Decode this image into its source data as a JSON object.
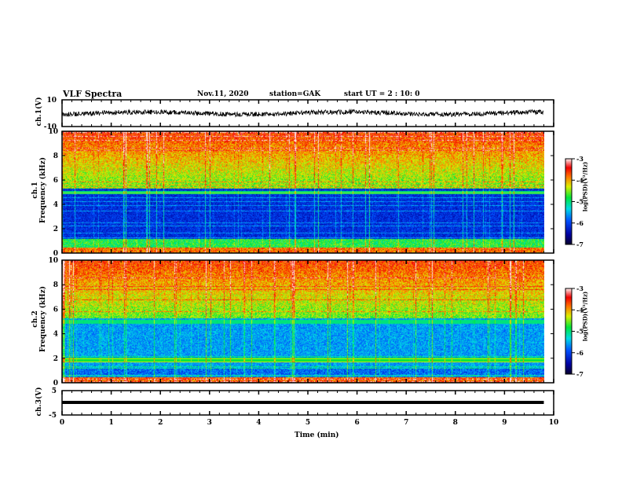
{
  "header": {
    "title": "VLF Spectra",
    "date": "Nov.11, 2020",
    "station": "station=GAK",
    "start": "start  UT =   2 : 10: 0"
  },
  "chart_data": [
    {
      "type": "line",
      "ylabel": "ch.1(V)",
      "ylim": [
        -10,
        10
      ],
      "yticks": [
        "10",
        "-10"
      ],
      "xlim": [
        0,
        10
      ],
      "note_values": "noisy waveform near 0 V from 0 to ~9.8 min"
    },
    {
      "type": "heatmap",
      "ylabel": "ch.1\nFrequency (kHz)",
      "ylabel_lines": [
        "ch.1",
        "Frequency (kHz)"
      ],
      "ylim": [
        0,
        10
      ],
      "yticks": [
        "0",
        "2",
        "4",
        "6",
        "8",
        "10"
      ],
      "xlim": [
        0,
        10
      ],
      "colorbar": {
        "label": "log(PSD)(V²/Hz)",
        "range": [
          -7,
          -3
        ],
        "ticks": [
          "-3",
          "-4",
          "-5",
          "-6",
          "-7"
        ]
      }
    },
    {
      "type": "heatmap",
      "ylabel_lines": [
        "ch.2",
        "Frequency (kHz)"
      ],
      "ylim": [
        0,
        10
      ],
      "yticks": [
        "0",
        "2",
        "4",
        "6",
        "8",
        "10"
      ],
      "xlim": [
        0,
        10
      ],
      "colorbar": {
        "label": "log(PSD)(V²/Hz)",
        "range": [
          -7,
          -3
        ],
        "ticks": [
          "-3",
          "-4",
          "-5",
          "-6",
          "-7"
        ]
      }
    },
    {
      "type": "line",
      "ylabel": "ch.3(V)",
      "ylim": [
        -5,
        5
      ],
      "yticks": [
        "5",
        "-5"
      ],
      "xlim": [
        0,
        10
      ],
      "note_values": "constant near -1 V"
    }
  ],
  "xaxis": {
    "label": "Time  (min)",
    "ticks": [
      "0",
      "1",
      "2",
      "3",
      "4",
      "5",
      "6",
      "7",
      "8",
      "9",
      "10"
    ]
  }
}
